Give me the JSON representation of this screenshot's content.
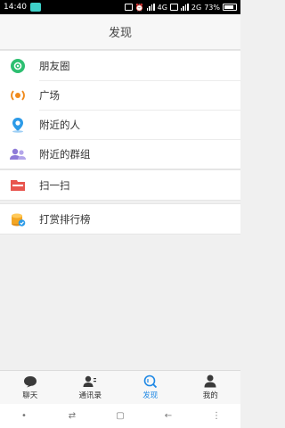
{
  "status": {
    "time": "14:40",
    "network1": "4G",
    "network2": "2G",
    "battery": "73%"
  },
  "header": {
    "title": "发现"
  },
  "menu": {
    "group1": [
      {
        "label": "朋友圈",
        "icon": "moments-icon",
        "color": "#2dbf71"
      },
      {
        "label": "广场",
        "icon": "broadcast-icon",
        "color": "#f08a1c"
      },
      {
        "label": "附近的人",
        "icon": "nearby-person-icon",
        "color": "#2d9be8"
      },
      {
        "label": "附近的群组",
        "icon": "nearby-group-icon",
        "color": "#8e7ad8"
      }
    ],
    "group2": [
      {
        "label": "扫一扫",
        "icon": "scan-icon",
        "color": "#e8554e"
      }
    ],
    "group3": [
      {
        "label": "打赏排行榜",
        "icon": "coin-rank-icon",
        "color": "#f4a623"
      }
    ]
  },
  "tabs": [
    {
      "label": "聊天",
      "icon": "chat-icon"
    },
    {
      "label": "通讯录",
      "icon": "contacts-icon"
    },
    {
      "label": "发现",
      "icon": "discover-icon",
      "active": true
    },
    {
      "label": "我的",
      "icon": "profile-icon"
    }
  ],
  "colors": {
    "accent": "#1e88e5",
    "statusbar": "#000000"
  }
}
